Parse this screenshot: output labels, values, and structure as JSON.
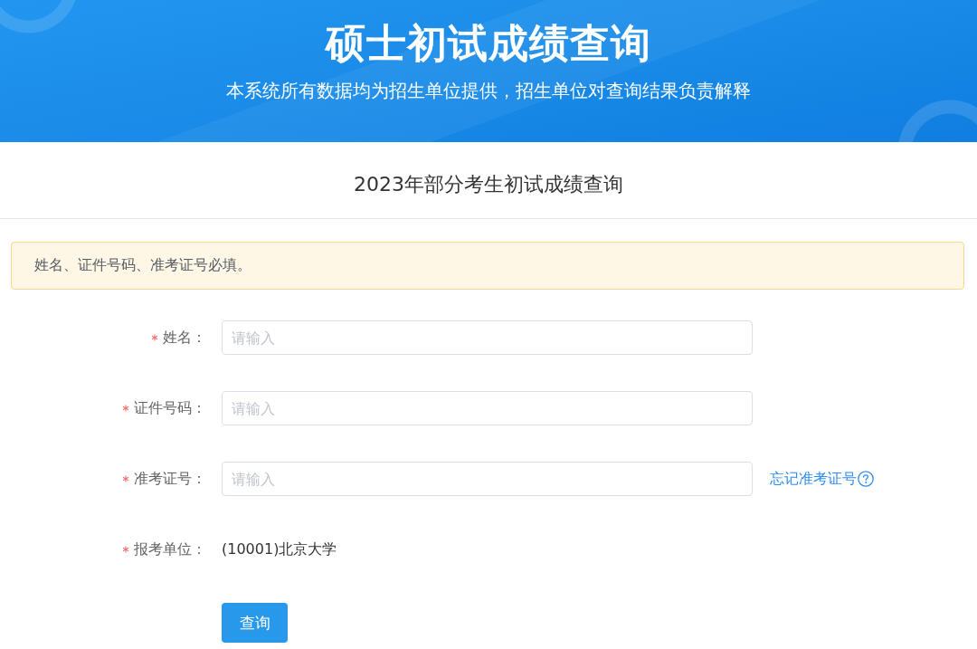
{
  "header": {
    "title": "硕士初试成绩查询",
    "subtitle": "本系统所有数据均为招生单位提供，招生单位对查询结果负责解释"
  },
  "page_heading": "2023年部分考生初试成绩查询",
  "alert": {
    "text": "姓名、证件号码、准考证号必填。"
  },
  "form": {
    "fields": [
      {
        "kind": "input",
        "label": "姓名：",
        "required": true,
        "placeholder": "请输入"
      },
      {
        "kind": "input",
        "label": "证件号码：",
        "required": true,
        "placeholder": "请输入"
      },
      {
        "kind": "input",
        "label": "准考证号：",
        "required": true,
        "placeholder": "请输入",
        "link": "忘记准考证号"
      },
      {
        "kind": "text",
        "label": "报考单位：",
        "required": true,
        "value": "(10001)北京大学"
      }
    ]
  },
  "submit_button": "查询"
}
